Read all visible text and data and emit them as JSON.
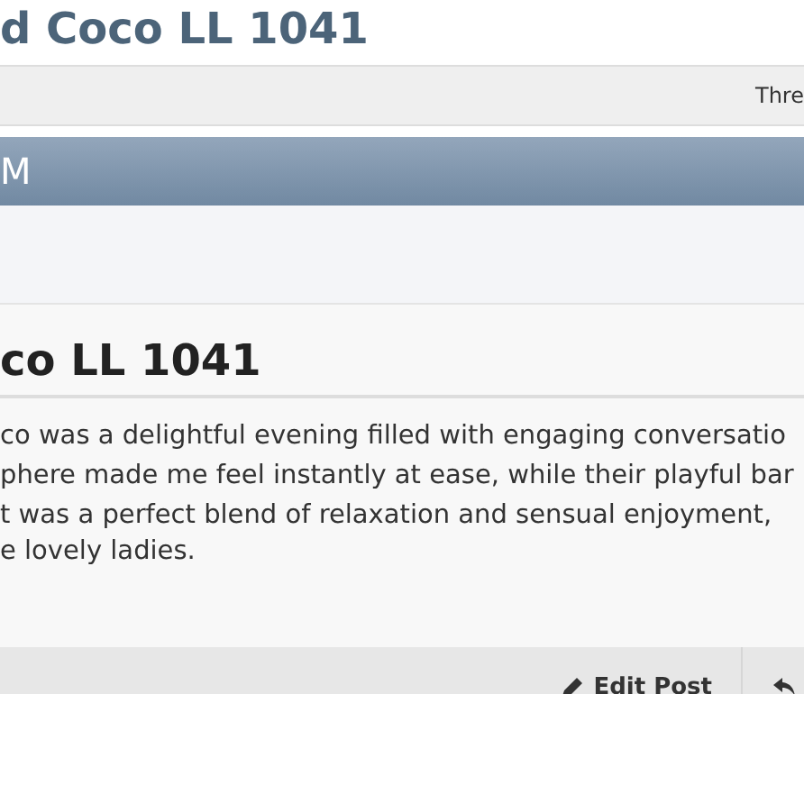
{
  "page_title": "d Coco LL 1041",
  "thread_bar": {
    "label": "Thre"
  },
  "section_header": {
    "title": "M"
  },
  "post": {
    "title": "co LL 1041",
    "lines": [
      "co was a delightful evening filled with engaging conversatio",
      "phere made me feel instantly at ease, while their playful bar",
      "t was a perfect blend of relaxation and sensual enjoyment,",
      "e lovely ladies."
    ],
    "actions": [
      {
        "kind": "edit",
        "label": "Edit Post"
      },
      {
        "kind": "reply"
      }
    ]
  }
}
